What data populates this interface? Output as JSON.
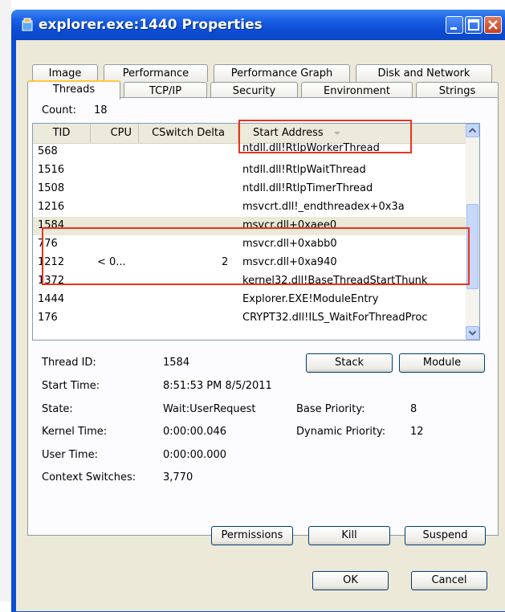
{
  "window": {
    "title": "explorer.exe:1440 Properties"
  },
  "tabs": {
    "row1": [
      "Image",
      "Performance",
      "Performance Graph",
      "Disk and Network"
    ],
    "row2": [
      "Threads",
      "TCP/IP",
      "Security",
      "Environment",
      "Strings"
    ],
    "active": "Threads"
  },
  "count": {
    "label": "Count:",
    "value": "18"
  },
  "columns": [
    "TID",
    "CPU",
    "CSwitch Delta",
    "Start Address"
  ],
  "rows": [
    {
      "tid": "568",
      "cpu": "",
      "cswitch": "",
      "start": "ntdll.dll!RtlpWorkerThread"
    },
    {
      "tid": "1516",
      "cpu": "",
      "cswitch": "",
      "start": "ntdll.dll!RtlpWaitThread"
    },
    {
      "tid": "1508",
      "cpu": "",
      "cswitch": "",
      "start": "ntdll.dll!RtlpTimerThread"
    },
    {
      "tid": "1216",
      "cpu": "",
      "cswitch": "",
      "start": "msvcrt.dll!_endthreadex+0x3a"
    },
    {
      "tid": "1584",
      "cpu": "",
      "cswitch": "",
      "start": "msvcr.dll+0xaee0"
    },
    {
      "tid": "776",
      "cpu": "",
      "cswitch": "",
      "start": "msvcr.dll+0xabb0"
    },
    {
      "tid": "1212",
      "cpu": "< 0...",
      "cswitch": "2",
      "start": "msvcr.dll+0xa940"
    },
    {
      "tid": "1372",
      "cpu": "",
      "cswitch": "",
      "start": "kernel32.dll!BaseThreadStartThunk"
    },
    {
      "tid": "1444",
      "cpu": "",
      "cswitch": "",
      "start": "Explorer.EXE!ModuleEntry"
    },
    {
      "tid": "176",
      "cpu": "",
      "cswitch": "",
      "start": "CRYPT32.dll!ILS_WaitForThreadProc"
    }
  ],
  "details": {
    "thread_id_label": "Thread ID:",
    "thread_id": "1584",
    "start_time_label": "Start Time:",
    "start_time": "8:51:53 PM  8/5/2011",
    "state_label": "State:",
    "state": "Wait:UserRequest",
    "base_priority_label": "Base Priority:",
    "base_priority": "8",
    "kernel_time_label": "Kernel Time:",
    "kernel_time": "0:00:00.046",
    "dynamic_priority_label": "Dynamic Priority:",
    "dynamic_priority": "12",
    "user_time_label": "User Time:",
    "user_time": "0:00:00.000",
    "context_switches_label": "Context Switches:",
    "context_switches": "3,770"
  },
  "buttons": {
    "stack": "Stack",
    "module": "Module",
    "permissions": "Permissions",
    "kill": "Kill",
    "suspend": "Suspend",
    "ok": "OK",
    "cancel": "Cancel"
  },
  "colors": {
    "highlight_box": "#e8341c",
    "selected_row": "#ece9d8",
    "titlebar": "#0b4cd4"
  },
  "icons": {
    "app": "explorer-icon",
    "minimize": "minimize-icon",
    "maximize": "maximize-icon",
    "close": "close-icon"
  }
}
